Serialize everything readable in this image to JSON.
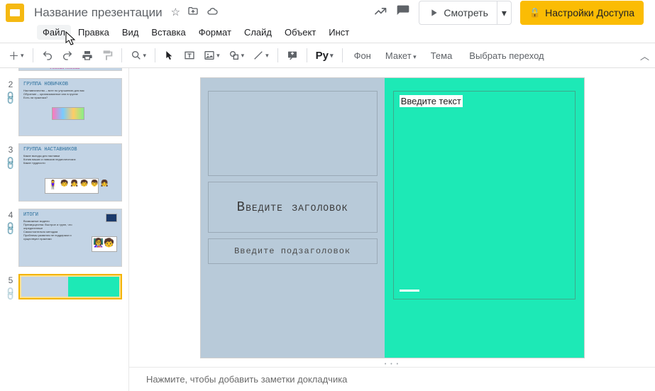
{
  "header": {
    "doc_title": "Название презентации",
    "watch_label": "Смотреть",
    "share_label": "Настройки Доступа"
  },
  "menu": {
    "file": "Файл",
    "edit": "Правка",
    "view": "Вид",
    "insert": "Вставка",
    "format": "Формат",
    "slide": "Слайд",
    "object": "Объект",
    "tools": "Инст"
  },
  "toolbar": {
    "bg_label": "Фон",
    "layout_label": "Макет",
    "theme_label": "Тема",
    "transition_label": "Выбрать переход"
  },
  "thumbs": {
    "t1": {
      "num": "",
      "label": ""
    },
    "t2": {
      "num": "2",
      "title": "ГРУППА НОВИЧКОВ",
      "line1": "Наставничество – всте по улучшению для вас",
      "line2": "Обучение – организованное или в группе",
      "line3": "Есть ли практика?"
    },
    "t3": {
      "num": "3",
      "title": "ГРУППА НАСТАВНИКОВ",
      "line1": "Какие выгоды для наставки",
      "line2": "Копия ваших и навыков педагогических",
      "line3": "Какие трудности"
    },
    "t4": {
      "num": "4",
      "title": "ИТОГИ",
      "line1": "Возможные модели",
      "line2": "Преимущества: быстрое и групп, что определенные",
      "line3": "Самостоятельно методам",
      "line4": "Проблемы развития не поддержки и существуют практики"
    },
    "t5": {
      "num": "5"
    }
  },
  "slide": {
    "title_placeholder": "Введите заголовок",
    "subtitle_placeholder": "Введите подзаголовок",
    "text_placeholder": "Введите текст"
  },
  "notes": {
    "placeholder": "Нажмите, чтобы добавить заметки докладчика"
  }
}
